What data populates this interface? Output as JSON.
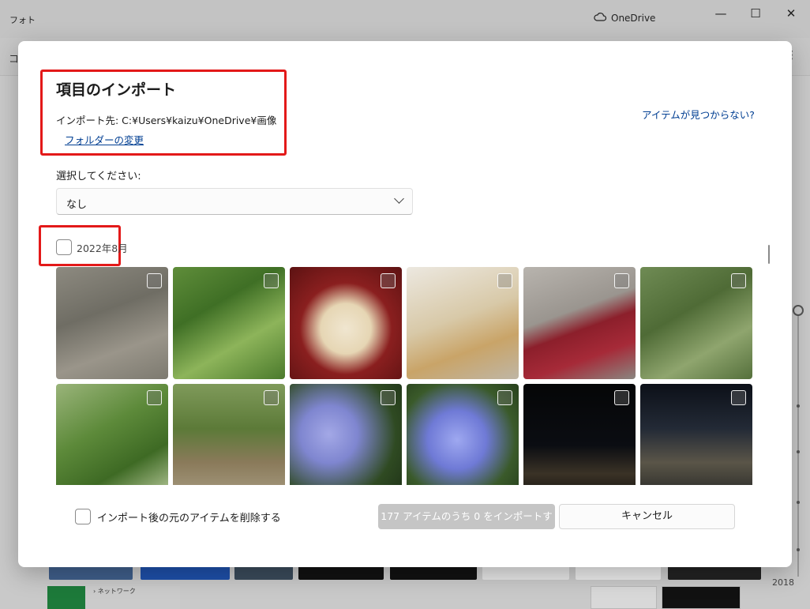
{
  "app": {
    "title": "フォト",
    "onedrive_label": "OneDrive",
    "toolbar_glyph": "コ",
    "minimize": "—",
    "maximize": "☐",
    "close": "✕",
    "more": "⋮",
    "timeline_year": "2018",
    "nav_item": "› ネットワーク"
  },
  "dialog": {
    "title": "項目のインポート",
    "destination": "インポート先: C:¥Users¥kaizu¥OneDrive¥画像",
    "change_folder": "フォルダーの変更",
    "not_found": "アイテムが見つからない?",
    "select_label": "選択してください:",
    "select_value": "なし",
    "group_label": "2022年8月",
    "delete_label": "インポート後の元のアイテムを削除する",
    "import_button": "177 アイテムのうち 0 をインポートする",
    "cancel_button": "キャンセル"
  },
  "photos": [
    {
      "name": "park-ball",
      "bg": "linear-gradient(160deg,#8d8a80 0%,#6f6d64 40%,#9a958a 70%,#7d7a70 100%)"
    },
    {
      "name": "leaves-fruit",
      "bg": "linear-gradient(150deg,#5f8d3a 0%,#3f6f25 35%,#8db45a 65%,#4b7a2c 100%)"
    },
    {
      "name": "hedgehog-bread",
      "bg": "radial-gradient(circle at 50% 55%,#f0e6d0 0%,#e6d6b4 30%,#8a1f1f 55%,#5c1212 100%)"
    },
    {
      "name": "chairs",
      "bg": "linear-gradient(160deg,#ece8e0 0%,#d8c9a8 45%,#c9a468 70%,#bfb6a5 100%)"
    },
    {
      "name": "mailbox",
      "bg": "linear-gradient(160deg,#b8b4ae 0%,#9a958f 40%,#8c1f2b 55%,#a62a38 75%,#8a8680 100%)"
    },
    {
      "name": "pine-grass",
      "bg": "linear-gradient(150deg,#6f8b54 0%,#4f6b36 40%,#8fa56e 70%,#55703c 100%)"
    },
    {
      "name": "green-leaves",
      "bg": "linear-gradient(150deg,#9ab47a 0%,#5d8a3a 40%,#3e6a24 70%,#b7c89a 100%)"
    },
    {
      "name": "tree-trunk",
      "bg": "linear-gradient(180deg,#7f9a5a 0%,#5c7a38 40%,#8a7a5a 70%,#a59a7f 100%)"
    },
    {
      "name": "hydrangea-1",
      "bg": "radial-gradient(circle at 35% 45%,#a3a8e6 0%,#7f86d0 30%,#2f4a22 70%,#1f3318 100%)"
    },
    {
      "name": "hydrangea-2",
      "bg": "radial-gradient(circle at 45% 50%,#9ea8f0 0%,#6f7ad6 35%,#3a5a2a 70%,#27401c 100%)"
    },
    {
      "name": "night-city-1",
      "bg": "linear-gradient(180deg,#050607 0%,#0b0d12 55%,#3a3226 80%,#1a1712 100%)"
    },
    {
      "name": "night-city-2",
      "bg": "linear-gradient(180deg,#0c1018 0%,#232a36 40%,#5a5548 70%,#2a2a28 100%)"
    }
  ]
}
